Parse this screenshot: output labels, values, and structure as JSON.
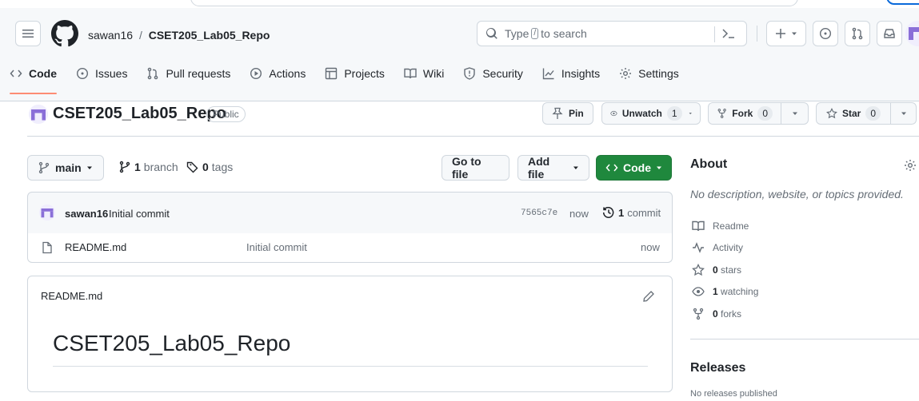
{
  "breadcrumb": {
    "owner": "sawan16",
    "separator": "/",
    "repo": "CSET205_Lab05_Repo"
  },
  "search": {
    "prefix": "Type",
    "key": "/",
    "suffix": "to search"
  },
  "tabs": [
    {
      "label": "Code",
      "icon": "code-icon"
    },
    {
      "label": "Issues",
      "icon": "issue-icon"
    },
    {
      "label": "Pull requests",
      "icon": "pull-request-icon"
    },
    {
      "label": "Actions",
      "icon": "play-icon"
    },
    {
      "label": "Projects",
      "icon": "table-icon"
    },
    {
      "label": "Wiki",
      "icon": "book-icon"
    },
    {
      "label": "Security",
      "icon": "shield-icon"
    },
    {
      "label": "Insights",
      "icon": "graph-icon"
    },
    {
      "label": "Settings",
      "icon": "gear-icon"
    }
  ],
  "repo": {
    "title": "CSET205_Lab05_Repo",
    "visibility": "Public",
    "pin_label": "Pin",
    "unwatch_label": "Unwatch",
    "watch_count": "1",
    "fork_label": "Fork",
    "fork_count": "0",
    "star_label": "Star",
    "star_count": "0"
  },
  "toolbar": {
    "branch": "main",
    "branches_count": "1",
    "branches_label": "branch",
    "tags_count": "0",
    "tags_label": "tags",
    "goto_file": "Go to file",
    "add_file": "Add file",
    "code": "Code"
  },
  "latest_commit": {
    "author": "sawan16",
    "message": "Initial commit",
    "sha": "7565c7e",
    "time": "now",
    "commits_count": "1",
    "commits_label": "commit"
  },
  "files": [
    {
      "name": "README.md",
      "message": "Initial commit",
      "time": "now"
    }
  ],
  "readme": {
    "filename": "README.md",
    "heading": "CSET205_Lab05_Repo"
  },
  "about": {
    "heading": "About",
    "description": "No description, website, or topics provided.",
    "readme": "Readme",
    "activity": "Activity",
    "stars_count": "0",
    "stars_label": "stars",
    "watching_count": "1",
    "watching_label": "watching",
    "forks_count": "0",
    "forks_label": "forks"
  },
  "releases": {
    "heading": "Releases",
    "empty": "No releases published"
  },
  "colors": {
    "accent_green": "#1f883d",
    "tab_underline": "#fd8c73",
    "border": "#d0d7de"
  }
}
